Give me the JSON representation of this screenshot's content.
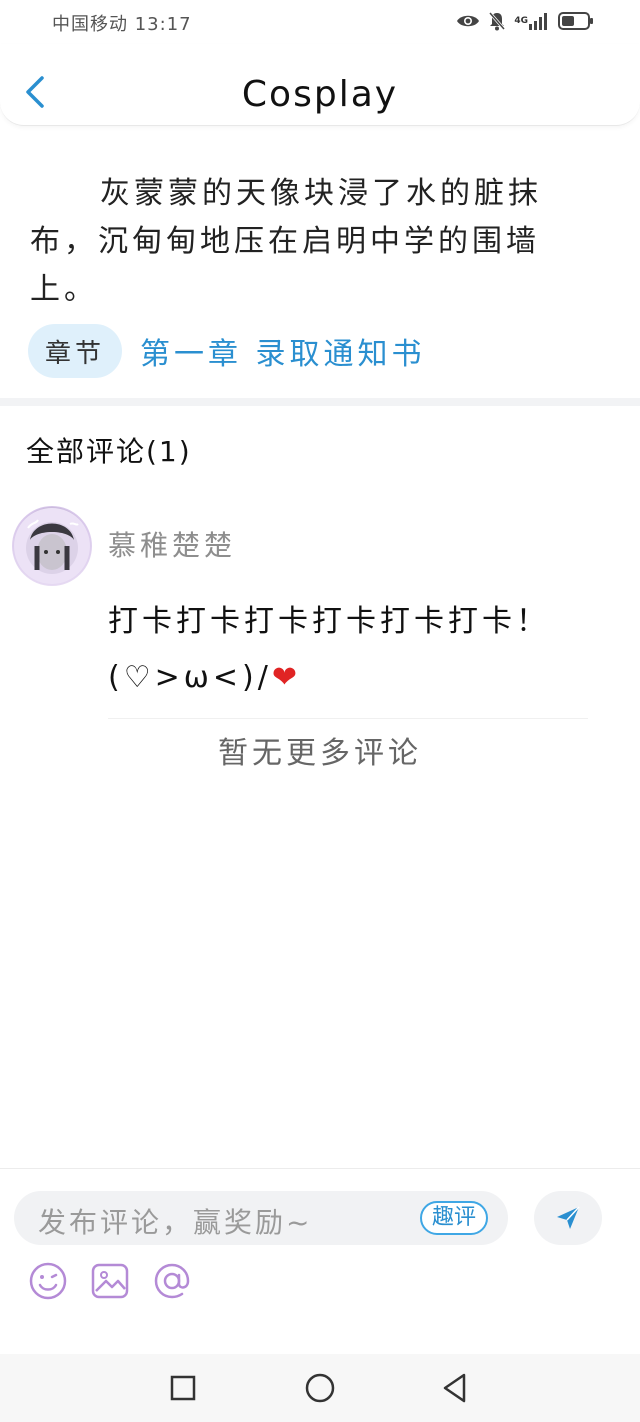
{
  "status_bar": {
    "carrier_time": "中国移动 13:17",
    "network": "4G"
  },
  "header": {
    "title": "Cosplay"
  },
  "excerpt": {
    "text": "灰蒙蒙的天像块浸了水的脏抹布，沉甸甸地压在启明中学的围墙上。"
  },
  "chapter": {
    "tag": "章节",
    "title": "第一章 录取通知书"
  },
  "comments": {
    "header": "全部评论(1)",
    "items": [
      {
        "author": "慕稚楚楚",
        "body": "打卡打卡打卡打卡打卡打卡！",
        "emoticon": "(♡>ω<)/",
        "emoji": "❤"
      }
    ],
    "no_more": "暂无更多评论"
  },
  "composer": {
    "placeholder": "发布评论，赢奖励~",
    "fun_button": "趣评"
  },
  "colors": {
    "accent": "#2a8fd0",
    "tag_bg": "#dff0fb",
    "tool_icon": "#b48ad6"
  }
}
